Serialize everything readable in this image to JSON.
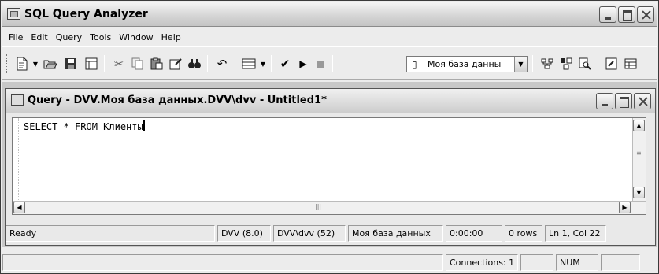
{
  "window": {
    "title": "SQL Query Analyzer",
    "icon": "query-analyzer-icon"
  },
  "menu": [
    "File",
    "Edit",
    "Query",
    "Tools",
    "Window",
    "Help"
  ],
  "toolbar": {
    "database_selected": "Моя база данны",
    "icons": [
      "new-query-icon",
      "open-icon",
      "save-icon",
      "insert-template-icon",
      "cut-icon",
      "copy-icon",
      "paste-icon",
      "clear-icon",
      "find-icon",
      "undo-icon",
      "results-mode-icon",
      "parse-check-icon",
      "execute-icon",
      "stop-icon",
      "database-icon",
      "execution-plan-icon",
      "object-browser-icon",
      "object-search-icon",
      "properties-icon",
      "results-pane-icon"
    ]
  },
  "query_window": {
    "title": "Query - DVV.Моя база данных.DVV\\dvv - Untitled1*",
    "sql_text": "SELECT * FROM Клиенты",
    "status": {
      "state": "Ready",
      "server": "DVV (8.0)",
      "user": "DVV\\dvv (52)",
      "database": "Моя база данных",
      "elapsed": "0:00:00",
      "rows": "0 rows",
      "position": "Ln 1, Col 22"
    }
  },
  "main_status": {
    "connections": "Connections: 1",
    "num": "NUM"
  }
}
